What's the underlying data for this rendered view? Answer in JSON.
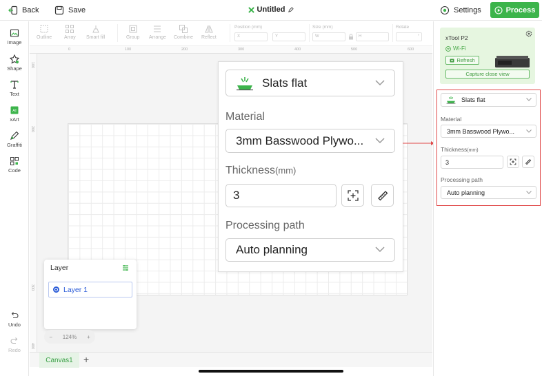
{
  "topbar": {
    "back_label": "Back",
    "save_label": "Save",
    "title": "Untitled",
    "settings_label": "Settings",
    "process_label": "Process"
  },
  "left_tools": [
    {
      "label": "Image",
      "icon": "image-icon"
    },
    {
      "label": "Shape",
      "icon": "shape-icon"
    },
    {
      "label": "Text",
      "icon": "text-icon"
    },
    {
      "label": "xArt",
      "icon": "xart-icon"
    },
    {
      "label": "Graffiti",
      "icon": "pen-icon"
    },
    {
      "label": "Code",
      "icon": "qr-code-icon"
    }
  ],
  "history": {
    "undo_label": "Undo",
    "redo_label": "Redo"
  },
  "sub_tools": {
    "outline": "Outline",
    "array": "Array",
    "smart_fill": "Smart fill",
    "group": "Group",
    "arrange": "Arrange",
    "combine": "Combine",
    "reflect": "Reflect",
    "position_label": "Position (mm)",
    "size_label": "Size (mm)",
    "rotate_label": "Rotate",
    "x_placeholder": "X",
    "y_placeholder": "Y",
    "w_placeholder": "W",
    "h_placeholder": "H",
    "rotate_placeholder": "°"
  },
  "rulers": {
    "top": [
      "0",
      "100",
      "200",
      "300",
      "400",
      "500",
      "600"
    ],
    "left": [
      "100",
      "200",
      "300",
      "400"
    ]
  },
  "zoom_panel": {
    "platform": "Slats flat",
    "material_label": "Material",
    "material_value": "3mm Basswood Plywo...",
    "thickness_label": "Thickness",
    "thickness_unit": "(mm)",
    "thickness_value": "3",
    "path_label": "Processing path",
    "path_value": "Auto planning"
  },
  "layer_panel": {
    "title": "Layer",
    "items": [
      "Layer 1"
    ]
  },
  "zoom_control": {
    "minus": "−",
    "value": "124%",
    "plus": "+"
  },
  "tabs": {
    "canvas": "Canvas1",
    "add": "+"
  },
  "device": {
    "name": "xTool P2",
    "wifi_label": "Wi-Fi",
    "refresh_label": "Refresh",
    "capture_label": "Capture close view"
  },
  "right_panel": {
    "platform": "Slats flat",
    "material_label": "Material",
    "material_value": "3mm Basswood Plywo...",
    "thickness_label": "Thickness",
    "thickness_unit": "(mm)",
    "thickness_value": "3",
    "path_label": "Processing path",
    "path_value": "Auto planning"
  },
  "colors": {
    "accent": "#3cb44b",
    "highlight": "#e04848",
    "layer_blue": "#2b5cd8"
  }
}
